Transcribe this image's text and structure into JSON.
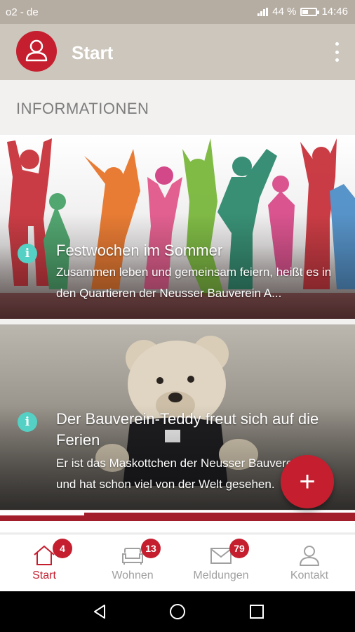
{
  "status_bar": {
    "carrier": "o2 - de",
    "battery_text": "44 %",
    "battery_level": 0.44,
    "time": "14:46"
  },
  "app_bar": {
    "title": "Start",
    "avatar_icon": "user-icon",
    "menu_icon": "more-vert-icon"
  },
  "section_title": "INFORMATIONEN",
  "cards": [
    {
      "title": "Festwochen im Sommer",
      "text": "Zusammen leben und gemeinsam feiern, heißt es in den Quartieren der Neusser Bauverein A...",
      "icon": "info-icon"
    },
    {
      "title": "Der Bauverein-Teddy freut sich auf die Ferien",
      "text": "Er ist das Maskottchen der Neusser Bauverein AG und hat schon viel von der Welt gesehen.",
      "icon": "info-icon"
    }
  ],
  "fab": {
    "label": "+"
  },
  "bottom_nav": [
    {
      "label": "Start",
      "badge": "4",
      "icon": "home-icon",
      "active": true
    },
    {
      "label": "Wohnen",
      "badge": "13",
      "icon": "sofa-icon",
      "active": false
    },
    {
      "label": "Meldungen",
      "badge": "79",
      "icon": "mail-icon",
      "active": false
    },
    {
      "label": "Kontakt",
      "badge": "",
      "icon": "person-icon",
      "active": false
    }
  ],
  "colors": {
    "accent": "#c51f2f",
    "info": "#54d1c4",
    "appbar": "#ccc6bc",
    "statusbar": "#b5ada2"
  }
}
